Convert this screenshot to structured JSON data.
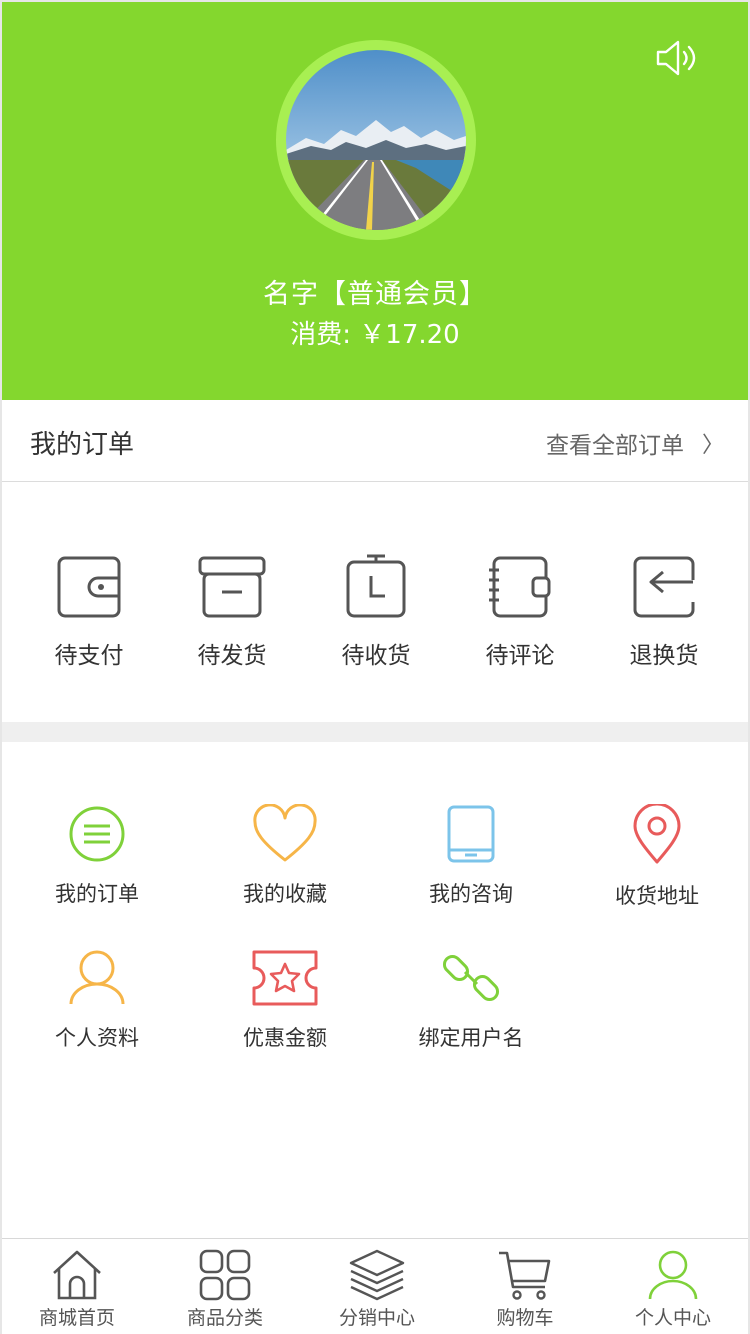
{
  "colors": {
    "brand_green": "#84d72e",
    "divider_gray": "#efefef"
  },
  "header": {
    "speaker_icon": "speaker-icon",
    "user_name": "名字【普通会员】",
    "spend": "消费: ￥17.20"
  },
  "orders": {
    "title": "我的订单",
    "view_all": "查看全部订单",
    "chevron": "〉",
    "statuses": [
      {
        "label": "待支付",
        "icon": "wallet-icon"
      },
      {
        "label": "待发货",
        "icon": "box-icon"
      },
      {
        "label": "待收货",
        "icon": "clipboard-clock-icon"
      },
      {
        "label": "待评论",
        "icon": "notebook-icon"
      },
      {
        "label": "退换货",
        "icon": "return-icon"
      }
    ]
  },
  "features": [
    {
      "label": "我的订单",
      "icon": "list-icon"
    },
    {
      "label": "我的收藏",
      "icon": "heart-icon"
    },
    {
      "label": "我的咨询",
      "icon": "tablet-icon"
    },
    {
      "label": "收货地址",
      "icon": "location-pin-icon"
    },
    {
      "label": "个人资料",
      "icon": "user-icon"
    },
    {
      "label": "优惠金额",
      "icon": "coupon-star-icon"
    },
    {
      "label": "绑定用户名",
      "icon": "link-icon"
    }
  ],
  "bottom_nav": [
    {
      "label": "商城首页",
      "icon": "home-icon"
    },
    {
      "label": "商品分类",
      "icon": "grid-icon"
    },
    {
      "label": "分销中心",
      "icon": "layers-icon"
    },
    {
      "label": "购物车",
      "icon": "cart-icon"
    },
    {
      "label": "个人中心",
      "icon": "profile-icon",
      "active": true
    }
  ]
}
